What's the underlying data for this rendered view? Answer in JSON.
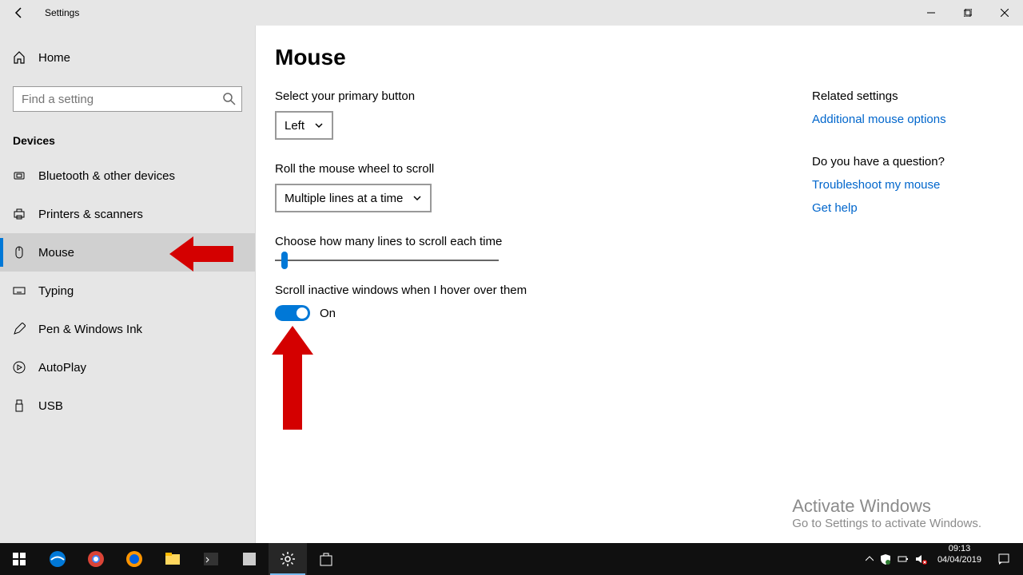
{
  "window": {
    "title": "Settings"
  },
  "sidebar": {
    "home": "Home",
    "search_placeholder": "Find a setting",
    "section": "Devices",
    "items": [
      {
        "label": "Bluetooth & other devices"
      },
      {
        "label": "Printers & scanners"
      },
      {
        "label": "Mouse"
      },
      {
        "label": "Typing"
      },
      {
        "label": "Pen & Windows Ink"
      },
      {
        "label": "AutoPlay"
      },
      {
        "label": "USB"
      }
    ]
  },
  "page": {
    "title": "Mouse",
    "primary_button_label": "Select your primary button",
    "primary_button_value": "Left",
    "scroll_wheel_label": "Roll the mouse wheel to scroll",
    "scroll_wheel_value": "Multiple lines at a time",
    "lines_label": "Choose how many lines to scroll each time",
    "inactive_label": "Scroll inactive windows when I hover over them",
    "inactive_state": "On"
  },
  "aside": {
    "related_header": "Related settings",
    "related_link": "Additional mouse options",
    "question_header": "Do you have a question?",
    "troubleshoot_link": "Troubleshoot my mouse",
    "help_link": "Get help"
  },
  "watermark": {
    "title": "Activate Windows",
    "sub": "Go to Settings to activate Windows."
  },
  "tray": {
    "time": "09:13",
    "date": "04/04/2019"
  }
}
